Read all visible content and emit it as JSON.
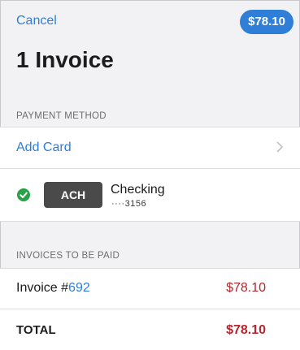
{
  "header": {
    "cancel_label": "Cancel",
    "pay_amount": "$78.10",
    "title": "1 Invoice"
  },
  "payment_method": {
    "section_title": "PAYMENT METHOD",
    "add_card_label": "Add Card",
    "selected_account": {
      "type_badge": "ACH",
      "name": "Checking",
      "number_masked": "····3156",
      "selected": true
    }
  },
  "invoices": {
    "section_title": "INVOICES TO BE PAID",
    "items": [
      {
        "label_prefix": "Invoice #",
        "number": "692",
        "amount": "$78.10"
      }
    ],
    "total_label": "TOTAL",
    "total_amount": "$78.10"
  },
  "colors": {
    "accent": "#2f7ed8",
    "amount_red": "#b5272d",
    "check_green": "#2aa148",
    "badge_dark": "#4a4a4a",
    "background": "#f2f2f4"
  },
  "icons": {
    "chevron": "chevron-right-icon",
    "check": "checkmark-circle-icon"
  }
}
